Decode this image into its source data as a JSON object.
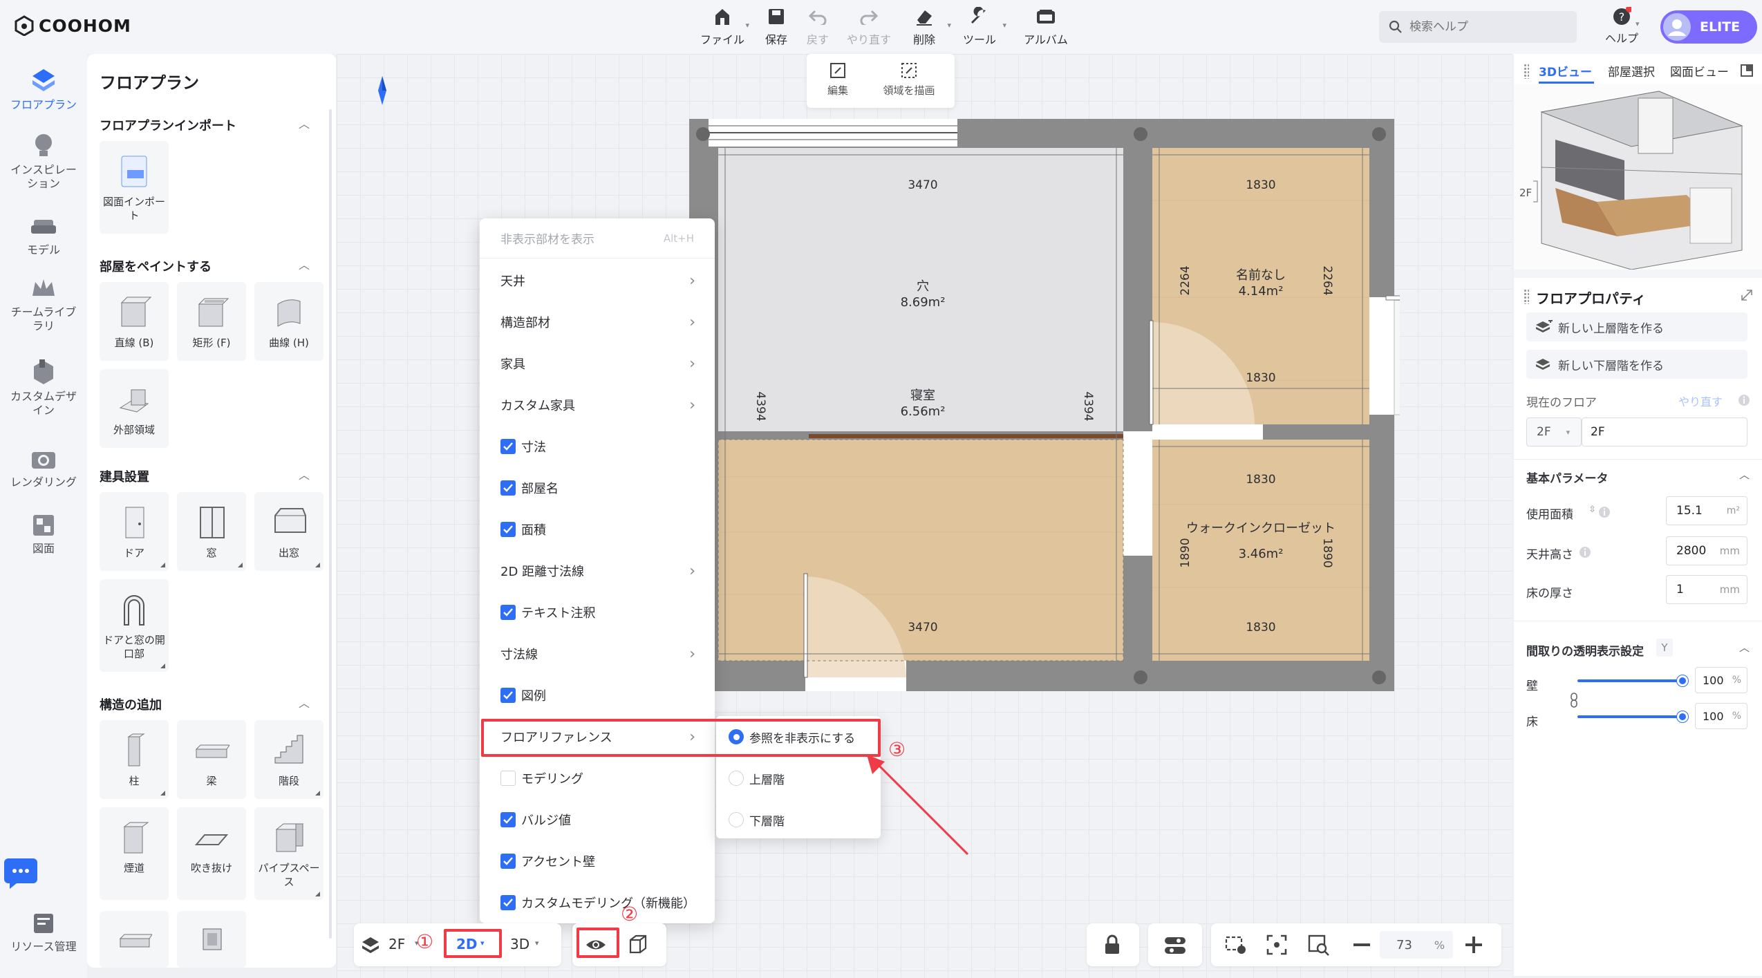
{
  "app": {
    "logo": "COOHOM",
    "badge": "ELITE"
  },
  "toolbar": {
    "file": "ファイル",
    "save": "保存",
    "undo": "戻す",
    "redo": "やり直す",
    "delete": "削除",
    "tools": "ツール",
    "album": "アルバム",
    "search_placeholder": "検索ヘルプ",
    "help": "ヘルプ"
  },
  "subtoolbar": {
    "edit": "編集",
    "draw_area": "領域を描画"
  },
  "leftnav": {
    "items": [
      {
        "label": "フロアプラン"
      },
      {
        "label": "インスピレーション"
      },
      {
        "label": "モデル"
      },
      {
        "label": "チームライブラリ"
      },
      {
        "label": "カスタムデザイン"
      },
      {
        "label": "レンダリング"
      },
      {
        "label": "図面"
      },
      {
        "label": "リソース管理"
      }
    ]
  },
  "leftpanel": {
    "title": "フロアプラン",
    "sec_import": "フロアプランインポート",
    "import_tile": "図面インポート",
    "sec_paint": "部屋をペイントする",
    "paint_tiles": [
      "直線 (B)",
      "矩形 (F)",
      "曲線 (H)",
      "外部領域"
    ],
    "sec_fixtures": "建具設置",
    "fixture_tiles": [
      "ドア",
      "窓",
      "出窓",
      "ドアと窓の開口部"
    ],
    "sec_struct": "構造の追加",
    "struct_tiles": [
      "柱",
      "梁",
      "階段",
      "煙道",
      "吹き抜け",
      "パイプスペース"
    ]
  },
  "menu": {
    "header": "非表示部材を表示",
    "shortcut": "Alt+H",
    "items": [
      "天井",
      "構造部材",
      "家具",
      "カスタム家具",
      "寸法",
      "部屋名",
      "面積",
      "2D 距離寸法線",
      "テキスト注釈",
      "寸法線",
      "図例",
      "フロアリファレンス",
      "モデリング",
      "バルジ値",
      "アクセント壁",
      "カスタムモデリング（新機能）"
    ]
  },
  "submenu": {
    "items": [
      "参照を非表示にする",
      "上層階",
      "下層階"
    ]
  },
  "annotations": {
    "n1": "①",
    "n2": "②",
    "n3": "③"
  },
  "bottom": {
    "floor": "2F",
    "mode2d": "2D",
    "mode3d": "3D",
    "zoom": "73",
    "zoom_unit": "%"
  },
  "floorplan": {
    "rooms": [
      {
        "name": "穴",
        "area": "8.69m²"
      },
      {
        "name": "寝室",
        "area": "6.56m²"
      },
      {
        "name": "名前なし",
        "area": "4.14m²"
      },
      {
        "name": "ウォークインクローゼット",
        "area": "3.46m²"
      }
    ],
    "dims": {
      "top_w": "3470",
      "bottom_w": "3470",
      "left_h": "4394",
      "right_h": "4394",
      "r1_w": "1830",
      "r1_w2": "1830",
      "r1_h": "2264",
      "r1_h2": "2264",
      "r2_w": "1830",
      "r2_w2": "1830",
      "r2_h": "1890",
      "r2_h2": "1890"
    }
  },
  "rightpanel": {
    "tabs": [
      "3Dビュー",
      "部屋選択",
      "図面ビュー"
    ],
    "floor_tag": "2F",
    "title": "フロアプロパティ",
    "btn_upper": "新しい上層階を作る",
    "btn_lower": "新しい下層階を作る",
    "current_floor": "現在のフロア",
    "redo": "やり直す",
    "floor_sel": "2F",
    "floor_name": "2F",
    "basic": "基本パラメータ",
    "area_label": "使用面積",
    "area_val": "15.1",
    "area_unit": "m²",
    "height_label": "天井高さ",
    "height_val": "2800",
    "height_unit": "mm",
    "thick_label": "床の厚さ",
    "thick_val": "1",
    "thick_unit": "mm",
    "trans": "間取りの透明表示設定",
    "trans_key": "Y",
    "wall": "壁",
    "wall_val": "100",
    "floor": "床",
    "floor_val": "100",
    "pct": "%"
  }
}
